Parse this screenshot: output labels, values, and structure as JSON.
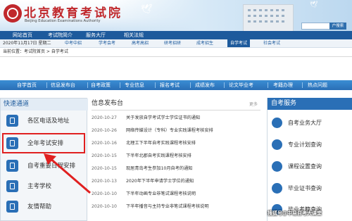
{
  "header": {
    "title": "北京教育考试院",
    "subtitle": "Beijing Education Examinations Authority",
    "search_button": "户搜索"
  },
  "main_nav": {
    "items": [
      "网站首页",
      "考试院简介",
      "服务大厅",
      "相关法规"
    ]
  },
  "date_bar": {
    "date": "2020年11月17日 星期二",
    "tabs": [
      "中考中招",
      "学考会考",
      "高考高招",
      "研考招研",
      "成考招生",
      "自学考试",
      "社会考试"
    ],
    "active_tab": "自学考试"
  },
  "breadcrumb": "当前位置：考试院首页 > 自学考试",
  "sub_nav": {
    "items": [
      "自学首页",
      "信息发布台",
      "自考政策",
      "专业信息",
      "报名考试",
      "成绩发布",
      "论文毕业考",
      "考籍办理",
      "热点问题"
    ]
  },
  "quick_access": {
    "title": "快速通道",
    "items": [
      "各区电话及地址",
      "全年考试安排",
      "自考重要日程安排",
      "主考学校",
      "友情帮助"
    ],
    "highlighted": "全年考试安排"
  },
  "info_board": {
    "title": "信息发布台",
    "more": "更多",
    "news": [
      {
        "date": "2020-10-27",
        "text": "关于发放自学考试学士学位证书的通知"
      },
      {
        "date": "2020-10-26",
        "text": "网络传媒设计（专科）专业实践课程考核安排"
      },
      {
        "date": "2020-10-16",
        "text": "北理工下半年自考实践课程考核安排"
      },
      {
        "date": "2020-10-15",
        "text": "下半年北郡自考实践课程考核安排"
      },
      {
        "date": "2020-10-15",
        "text": "现居青岛考生参加10月自考的通知"
      },
      {
        "date": "2020-10-13",
        "text": "2020年下半年申请学士学位的通知"
      },
      {
        "date": "2020-10-10",
        "text": "下半年动画专业非笔试课程考核说明"
      },
      {
        "date": "2020-10-10",
        "text": "下半年播音与主持专业非笔试课程考核说明"
      }
    ]
  },
  "services": {
    "title": "自考服务",
    "items": [
      "自考业务大厅",
      "专业计划查询",
      "课程设置查询",
      "毕业证书查询",
      "毕业考籍查询"
    ]
  },
  "watermark": "搜狐号@中易自考大课堂",
  "colors": {
    "brand_red": "#c0282c",
    "nav_blue": "#1d5a9c",
    "highlight": "#e02020"
  }
}
